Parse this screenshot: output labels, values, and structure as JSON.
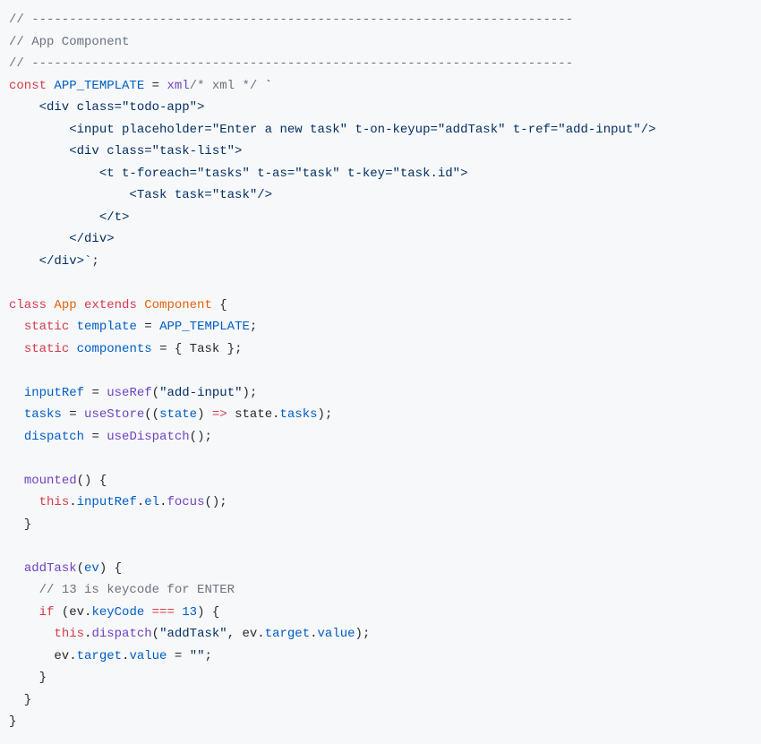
{
  "lines": {
    "l01a": "// ------------------------------------------------------------------------",
    "l02a": "// App Component",
    "l03a": "// ------------------------------------------------------------------------",
    "l04_const": "const",
    "l04_name": " APP_TEMPLATE ",
    "l04_eq": "= ",
    "l04_xml": "xml",
    "l04_cmt": "/* xml */",
    "l04_bt": " `",
    "l05": "    <div class=\"todo-app\">",
    "l06": "        <input placeholder=\"Enter a new task\" t-on-keyup=\"addTask\" t-ref=\"add-input\"/>",
    "l07": "        <div class=\"task-list\">",
    "l08": "            <t t-foreach=\"tasks\" t-as=\"task\" t-key=\"task.id\">",
    "l09": "                <Task task=\"task\"/>",
    "l10": "            </t>",
    "l11": "        </div>",
    "l12a": "    </div>`",
    "l12b": ";",
    "l13": "",
    "l14_class": "class",
    "l14_app": " App ",
    "l14_ext": "extends",
    "l14_comp": " Component ",
    "l14_br": "{",
    "l15_ind": "  ",
    "l15_static": "static",
    "l15_tmpl": " template ",
    "l15_eq": "= ",
    "l15_val": "APP_TEMPLATE",
    "l15_sc": ";",
    "l16_ind": "  ",
    "l16_static": "static",
    "l16_comp": " components ",
    "l16_eq": "= { ",
    "l16_task": "Task",
    "l16_end": " };",
    "l17": "",
    "l18_ind": "  ",
    "l18_name": "inputRef ",
    "l18_eq": "= ",
    "l18_fn": "useRef",
    "l18_p1": "(",
    "l18_str": "\"add-input\"",
    "l18_p2": ");",
    "l19_ind": "  ",
    "l19_name": "tasks ",
    "l19_eq": "= ",
    "l19_fn": "useStore",
    "l19_p1": "((",
    "l19_state": "state",
    "l19_p2": ") ",
    "l19_arrow": "=>",
    "l19_p3": " state.",
    "l19_prop": "tasks",
    "l19_p4": ");",
    "l20_ind": "  ",
    "l20_name": "dispatch ",
    "l20_eq": "= ",
    "l20_fn": "useDispatch",
    "l20_p": "();",
    "l21": "",
    "l22_ind": "  ",
    "l22_fn": "mounted",
    "l22_p": "() {",
    "l23_ind": "    ",
    "l23_this": "this",
    "l23_d1": ".",
    "l23_ir": "inputRef",
    "l23_d2": ".",
    "l23_el": "el",
    "l23_d3": ".",
    "l23_focus": "focus",
    "l23_p": "();",
    "l24": "  }",
    "l25": "",
    "l26_ind": "  ",
    "l26_fn": "addTask",
    "l26_p1": "(",
    "l26_ev": "ev",
    "l26_p2": ") {",
    "l27_ind": "    ",
    "l27_cmt": "// 13 is keycode for ENTER",
    "l28_ind": "    ",
    "l28_if": "if",
    "l28_p1": " (ev.",
    "l28_kc": "keyCode",
    "l28_eq": " === ",
    "l28_13": "13",
    "l28_p2": ") {",
    "l29_ind": "      ",
    "l29_this": "this",
    "l29_d": ".",
    "l29_disp": "dispatch",
    "l29_p1": "(",
    "l29_str": "\"addTask\"",
    "l29_c": ", ev.",
    "l29_tgt": "target",
    "l29_d2": ".",
    "l29_val": "value",
    "l29_p2": ");",
    "l30_ind": "      ev.",
    "l30_tgt": "target",
    "l30_d": ".",
    "l30_val": "value",
    "l30_eq": " = ",
    "l30_str": "\"\"",
    "l30_sc": ";",
    "l31": "    }",
    "l32": "  }",
    "l33": "}"
  }
}
